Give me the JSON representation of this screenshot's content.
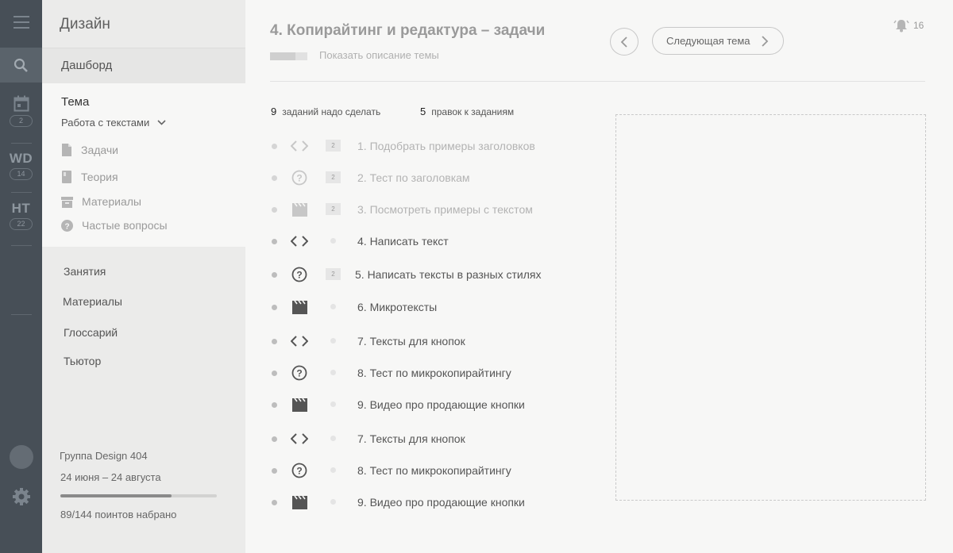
{
  "rail": {
    "calendar_badge": "2",
    "courses": [
      {
        "code": "WD",
        "badge": "14"
      },
      {
        "code": "HT",
        "badge": "22"
      }
    ]
  },
  "panel": {
    "title": "Дизайн",
    "dashboard": "Дашборд",
    "topic_label": "Тема",
    "topic_value": "Работа с текстами",
    "sub_items": [
      {
        "icon": "file-icon",
        "label": "Задачи"
      },
      {
        "icon": "book-icon",
        "label": "Теория"
      },
      {
        "icon": "archive-icon",
        "label": "Материалы"
      },
      {
        "icon": "help-icon",
        "label": "Частые вопросы"
      }
    ],
    "nav": [
      "Занятия",
      "Материалы",
      "Глоссарий",
      "Тьютор"
    ],
    "group_name": "Группа Design 404",
    "group_dates": "24 июня – 24 августа",
    "points_text": "89/144 поинтов набрано",
    "points_progress": 0.71
  },
  "main": {
    "title": "4. Копирайтинг и редактура – задачи",
    "show_description": "Показать описание темы",
    "next_topic": "Следующая тема",
    "notifications": "16",
    "stats": {
      "tasks_count": "9",
      "tasks_label": "заданий надо сделать",
      "edits_count": "5",
      "edits_label": "правок к заданиям"
    },
    "tasks": [
      {
        "icon": "code-icon",
        "badge": "2",
        "label": "1. Подобрать примеры заголовков",
        "state": "faded"
      },
      {
        "icon": "question-icon",
        "badge": "2",
        "label": "2. Тест по заголовкам",
        "state": "faded"
      },
      {
        "icon": "video-icon",
        "badge": "2",
        "label": "3. Посмотреть примеры с текстом",
        "state": "faded"
      },
      {
        "icon": "code-icon",
        "badge": "",
        "label": "4. Написать текст",
        "state": "active"
      },
      {
        "icon": "question-icon",
        "badge": "2",
        "label": "5. Написать тексты в разных стилях",
        "state": "active"
      },
      {
        "icon": "video-icon",
        "badge": "",
        "label": "6. Микротексты",
        "state": "active"
      },
      {
        "icon": "code-icon",
        "badge": "",
        "label": "7. Тексты для кнопок",
        "state": "active"
      },
      {
        "icon": "question-icon",
        "badge": "",
        "label": "8. Тест по микрокопирайтингу",
        "state": "active"
      },
      {
        "icon": "video-icon",
        "badge": "",
        "label": "9. Видео про продающие кнопки",
        "state": "active"
      },
      {
        "icon": "code-icon",
        "badge": "",
        "label": "7. Тексты для кнопок",
        "state": "active"
      },
      {
        "icon": "question-icon",
        "badge": "",
        "label": "8. Тест по микрокопирайтингу",
        "state": "active"
      },
      {
        "icon": "video-icon",
        "badge": "",
        "label": "9. Видео про продающие кнопки",
        "state": "active"
      }
    ]
  }
}
